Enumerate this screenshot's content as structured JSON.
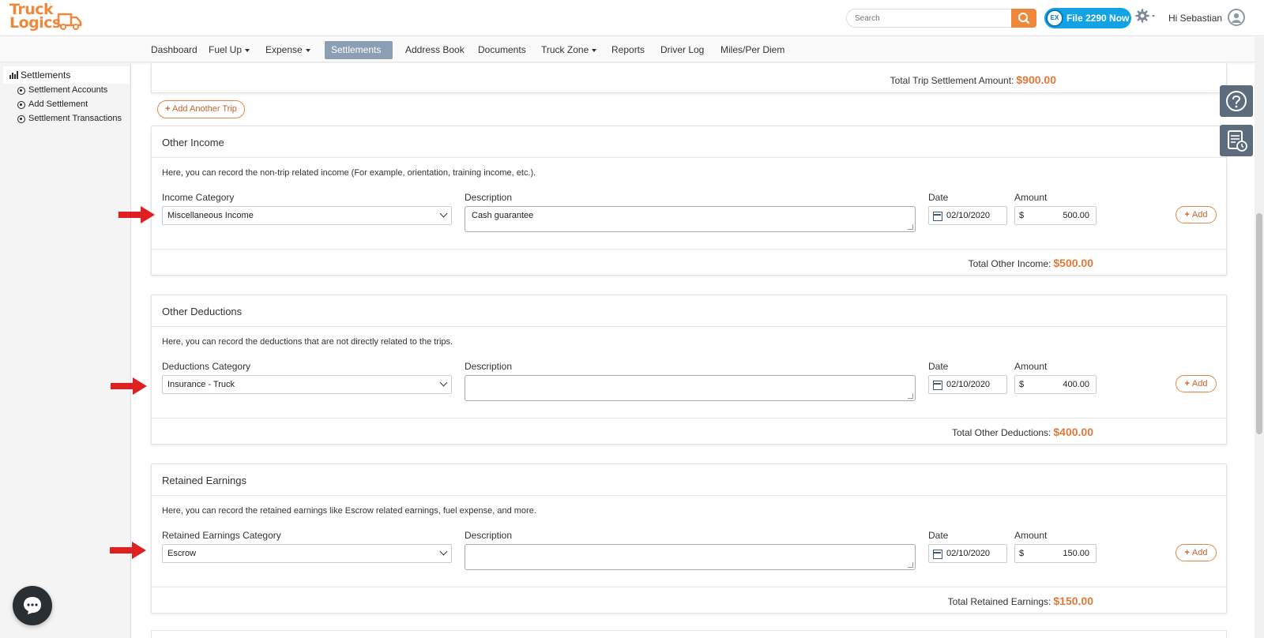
{
  "header": {
    "logo_line1": "Truck",
    "logo_line2": "Logics",
    "search_placeholder": "Search",
    "file_button_badge": "EX",
    "file_button_label": "File 2290 Now",
    "greeting": "Hi Sebastian"
  },
  "nav": {
    "items": [
      {
        "label": "Dashboard"
      },
      {
        "label": "Fuel Up"
      },
      {
        "label": "Expense"
      },
      {
        "label": "Settlements"
      },
      {
        "label": "Address Book"
      },
      {
        "label": "Documents"
      },
      {
        "label": "Truck Zone"
      },
      {
        "label": "Reports"
      },
      {
        "label": "Driver Log"
      },
      {
        "label": "Miles/Per Diem"
      }
    ]
  },
  "sidebar": {
    "title": "Settlements",
    "items": [
      {
        "label": "Settlement Accounts"
      },
      {
        "label": "Add Settlement"
      },
      {
        "label": "Settlement Transactions"
      }
    ]
  },
  "trip": {
    "total_label": "Total Trip Settlement Amount:",
    "total_value": "$900.00",
    "add_another_label": "Add Another Trip"
  },
  "field_labels": {
    "description": "Description",
    "date": "Date",
    "amount": "Amount",
    "currency": "$",
    "add": "Add"
  },
  "sections": [
    {
      "title": "Other Income",
      "desc": "Here, you can record the non-trip related income (For example, orientation, training income, etc.).",
      "category_label": "Income Category",
      "category_value": "Miscellaneous Income",
      "description_value": "Cash guarantee",
      "date": "02/10/2020",
      "amount": "500.00",
      "total_label": "Total Other Income:",
      "total_value": "$500.00"
    },
    {
      "title": "Other Deductions",
      "desc": "Here, you can record the deductions that are not directly related to the trips.",
      "category_label": "Deductions Category",
      "category_value": "Insurance - Truck",
      "description_value": "",
      "date": "02/10/2020",
      "amount": "400.00",
      "total_label": "Total Other Deductions:",
      "total_value": "$400.00"
    },
    {
      "title": "Retained Earnings",
      "desc": "Here, you can record the retained earnings like Escrow related earnings, fuel expense, and more.",
      "category_label": "Retained Earnings Category",
      "category_value": "Escrow",
      "description_value": "",
      "date": "02/10/2020",
      "amount": "150.00",
      "total_label": "Total Retained Earnings:",
      "total_value": "$150.00"
    }
  ],
  "colors": {
    "accent_orange": "#e2793a",
    "nav_active": "#8a9fb3",
    "file_button": "#11a3e6",
    "arrow_red": "#e02020"
  }
}
